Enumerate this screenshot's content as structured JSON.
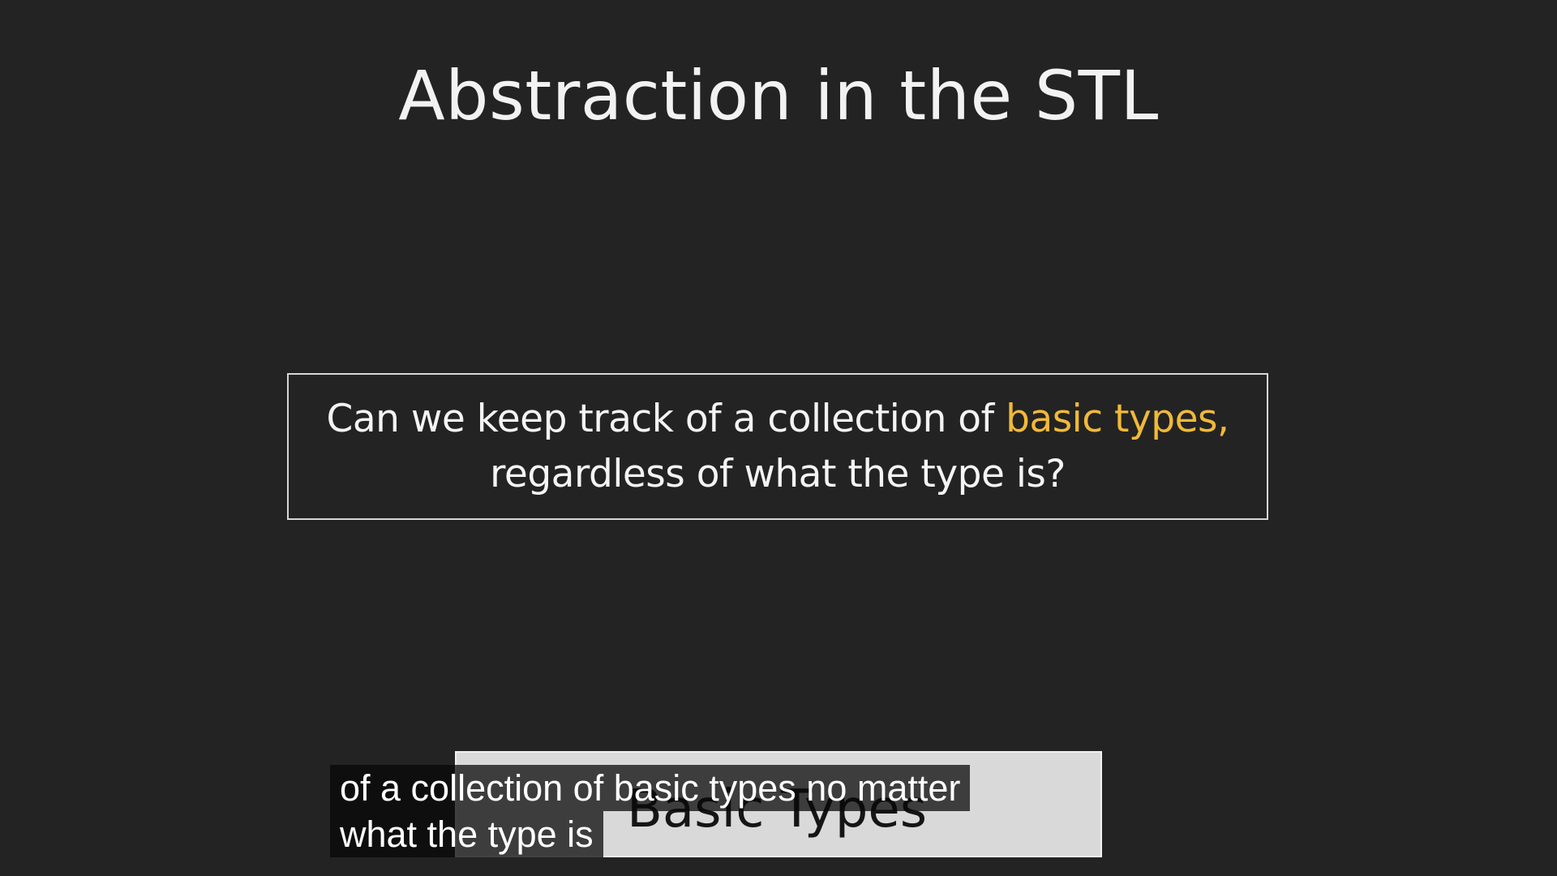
{
  "slide": {
    "title": "Abstraction in the STL",
    "question": {
      "line1_prefix": "Can we keep track of a collection of ",
      "line1_highlight": "basic types,",
      "line2": "regardless of what the type is?"
    },
    "highlight_color": "#f0b93a",
    "background_color": "#232323"
  },
  "card": {
    "label": "Basic Types"
  },
  "captions": {
    "line1": "of a collection of basic types no matter",
    "line2": "what the type is"
  }
}
